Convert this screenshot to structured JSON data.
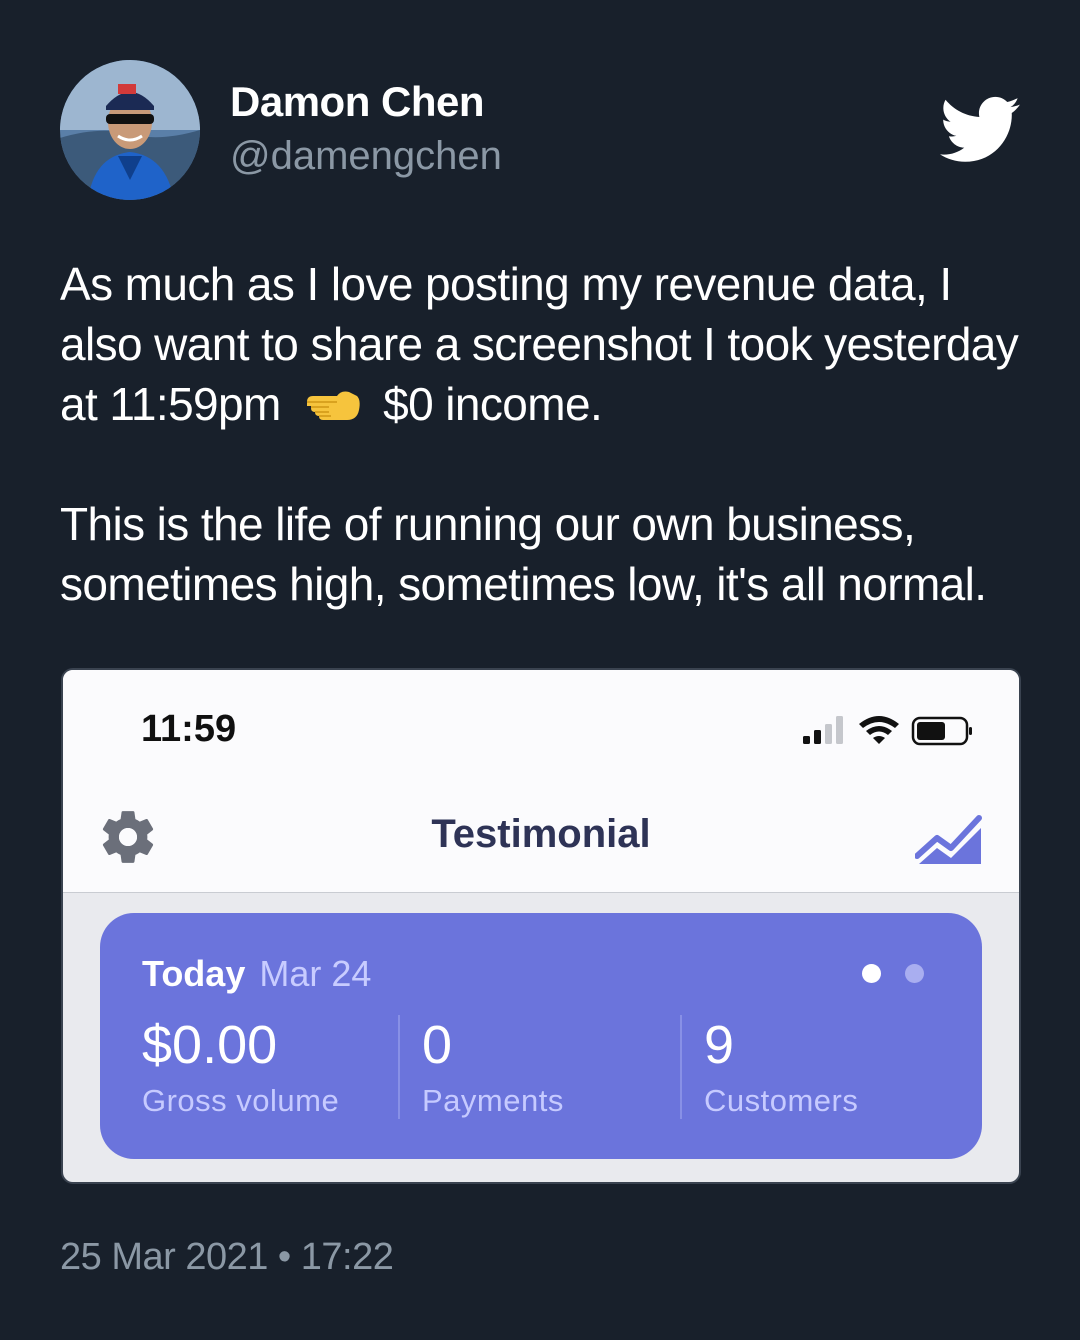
{
  "tweet": {
    "author_name": "Damon Chen",
    "author_handle": "@damengchen",
    "text_line1_before_emoji": "As much as I love posting my revenue data, I also want to share a screenshot I took yesterday at 11:59pm",
    "text_line1_emoji": "backhand-index-pointing-left-icon",
    "text_line1_after_emoji": "$0 income.",
    "text_para2": "This is the life of running our own business, sometimes high, sometimes low, it's all normal.",
    "timestamp": "25 Mar 2021 • 17:22"
  },
  "screenshot": {
    "status_time": "11:59",
    "app_title": "Testimonial",
    "today_label": "Today",
    "today_date": "Mar 24",
    "page_dots": {
      "count": 2,
      "active_index": 0
    },
    "stats": [
      {
        "value": "$0.00",
        "label": "Gross volume"
      },
      {
        "value": "0",
        "label": "Payments"
      },
      {
        "value": "9",
        "label": "Customers"
      }
    ]
  },
  "colors": {
    "background": "#18202b",
    "card_accent": "#6b74dc",
    "twitter_white": "#ffffff",
    "muted_text": "#8b98a5"
  }
}
